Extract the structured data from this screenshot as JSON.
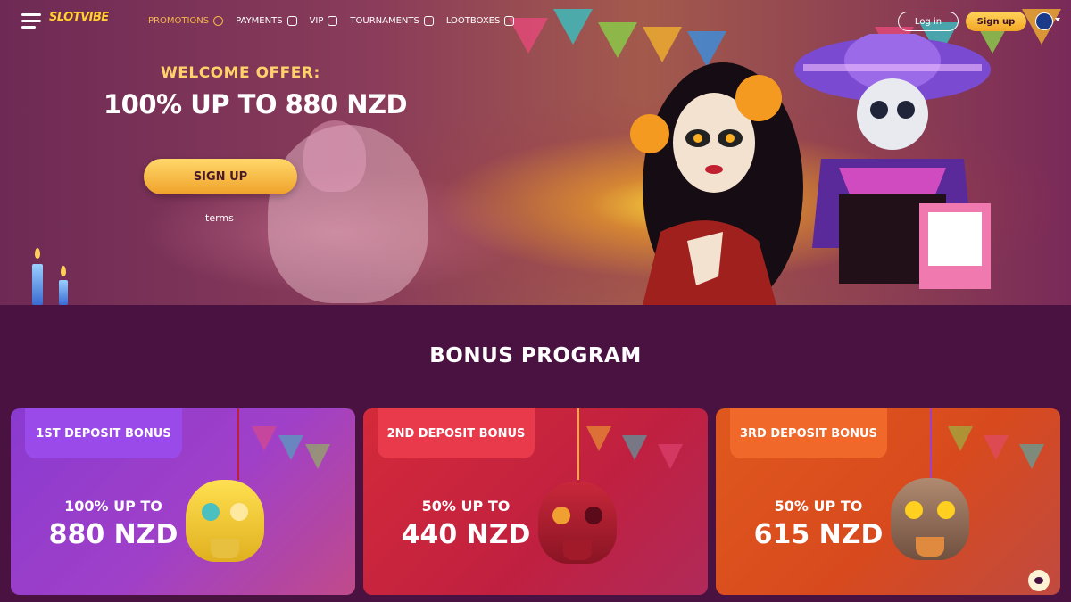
{
  "brand": {
    "logo_text": "SLOTVIBE"
  },
  "nav": {
    "items": [
      {
        "label": "PROMOTIONS",
        "active": true
      },
      {
        "label": "PAYMENTS",
        "active": false
      },
      {
        "label": "VIP",
        "active": false
      },
      {
        "label": "TOURNAMENTS",
        "active": false
      },
      {
        "label": "LOOTBOXES",
        "active": false
      }
    ],
    "login_label": "Log in",
    "signup_label": "Sign up"
  },
  "hero": {
    "welcome": "WELCOME OFFER:",
    "offer": "100% UP TO 880 NZD",
    "signup_label": "SIGN UP",
    "terms_label": "terms"
  },
  "bonus": {
    "title": "BONUS PROGRAM",
    "cards": [
      {
        "tag": "1ST DEPOSIT BONUS",
        "line1": "100% UP TO",
        "line2": "880 NZD"
      },
      {
        "tag": "2ND DEPOSIT BONUS",
        "line1": "50% UP TO",
        "line2": "440 NZD"
      },
      {
        "tag": "3RD DEPOSIT BONUS",
        "line1": "50% UP TO",
        "line2": "615 NZD"
      }
    ]
  },
  "colors": {
    "page_bg": "#4a1240",
    "accent_gold": "#f5b84a",
    "card1": "#8a3ad0",
    "card2": "#d42a3a",
    "card3": "#e0581e"
  },
  "icons": [
    "menu-icon",
    "promotions-icon",
    "payments-icon",
    "vip-icon",
    "tournaments-icon",
    "lootboxes-icon",
    "flag-icon",
    "chat-icon"
  ]
}
